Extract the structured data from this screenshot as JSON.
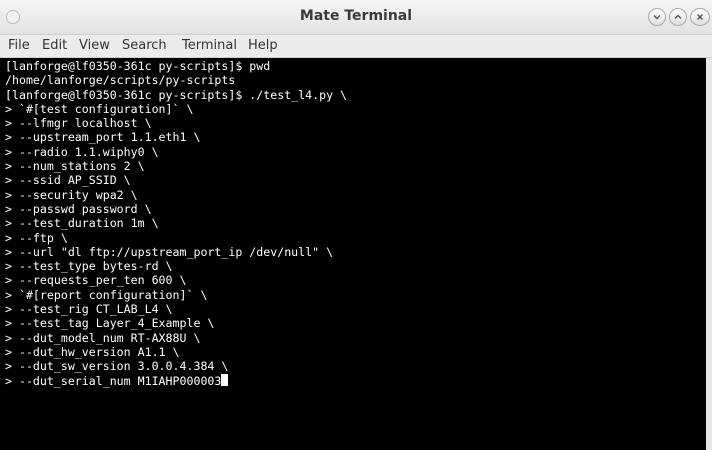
{
  "window": {
    "title": "Mate Terminal"
  },
  "menu": [
    "File",
    "Edit",
    "View",
    "Search",
    "Terminal",
    "Help"
  ],
  "terminal": {
    "lines": [
      "[lanforge@lf0350-361c py-scripts]$ pwd",
      "/home/lanforge/scripts/py-scripts",
      "[lanforge@lf0350-361c py-scripts]$ ./test_l4.py \\",
      "> `#[test configuration]` \\",
      "> --lfmgr localhost \\",
      "> --upstream_port 1.1.eth1 \\",
      "> --radio 1.1.wiphy0 \\",
      "> --num_stations 2 \\",
      "> --ssid AP_SSID \\",
      "> --security wpa2 \\",
      "> --passwd password \\",
      "> --test_duration 1m \\",
      "> --ftp \\",
      "> --url \"dl ftp://upstream_port_ip /dev/null\" \\",
      "> --test_type bytes-rd \\",
      "> --requests_per_ten 600 \\",
      "> `#[report configuration]` \\",
      "> --test_rig CT_LAB_L4 \\",
      "> --test_tag Layer_4_Example \\",
      "> --dut_model_num RT-AX88U \\",
      "> --dut_hw_version A1.1 \\",
      "> --dut_sw_version 3.0.0.4.384 \\",
      "> --dut_serial_num M1IAHP000003"
    ]
  },
  "icons": {
    "minimize": "chevron-down-icon",
    "maximize": "chevron-up-icon",
    "close": "close-icon"
  }
}
